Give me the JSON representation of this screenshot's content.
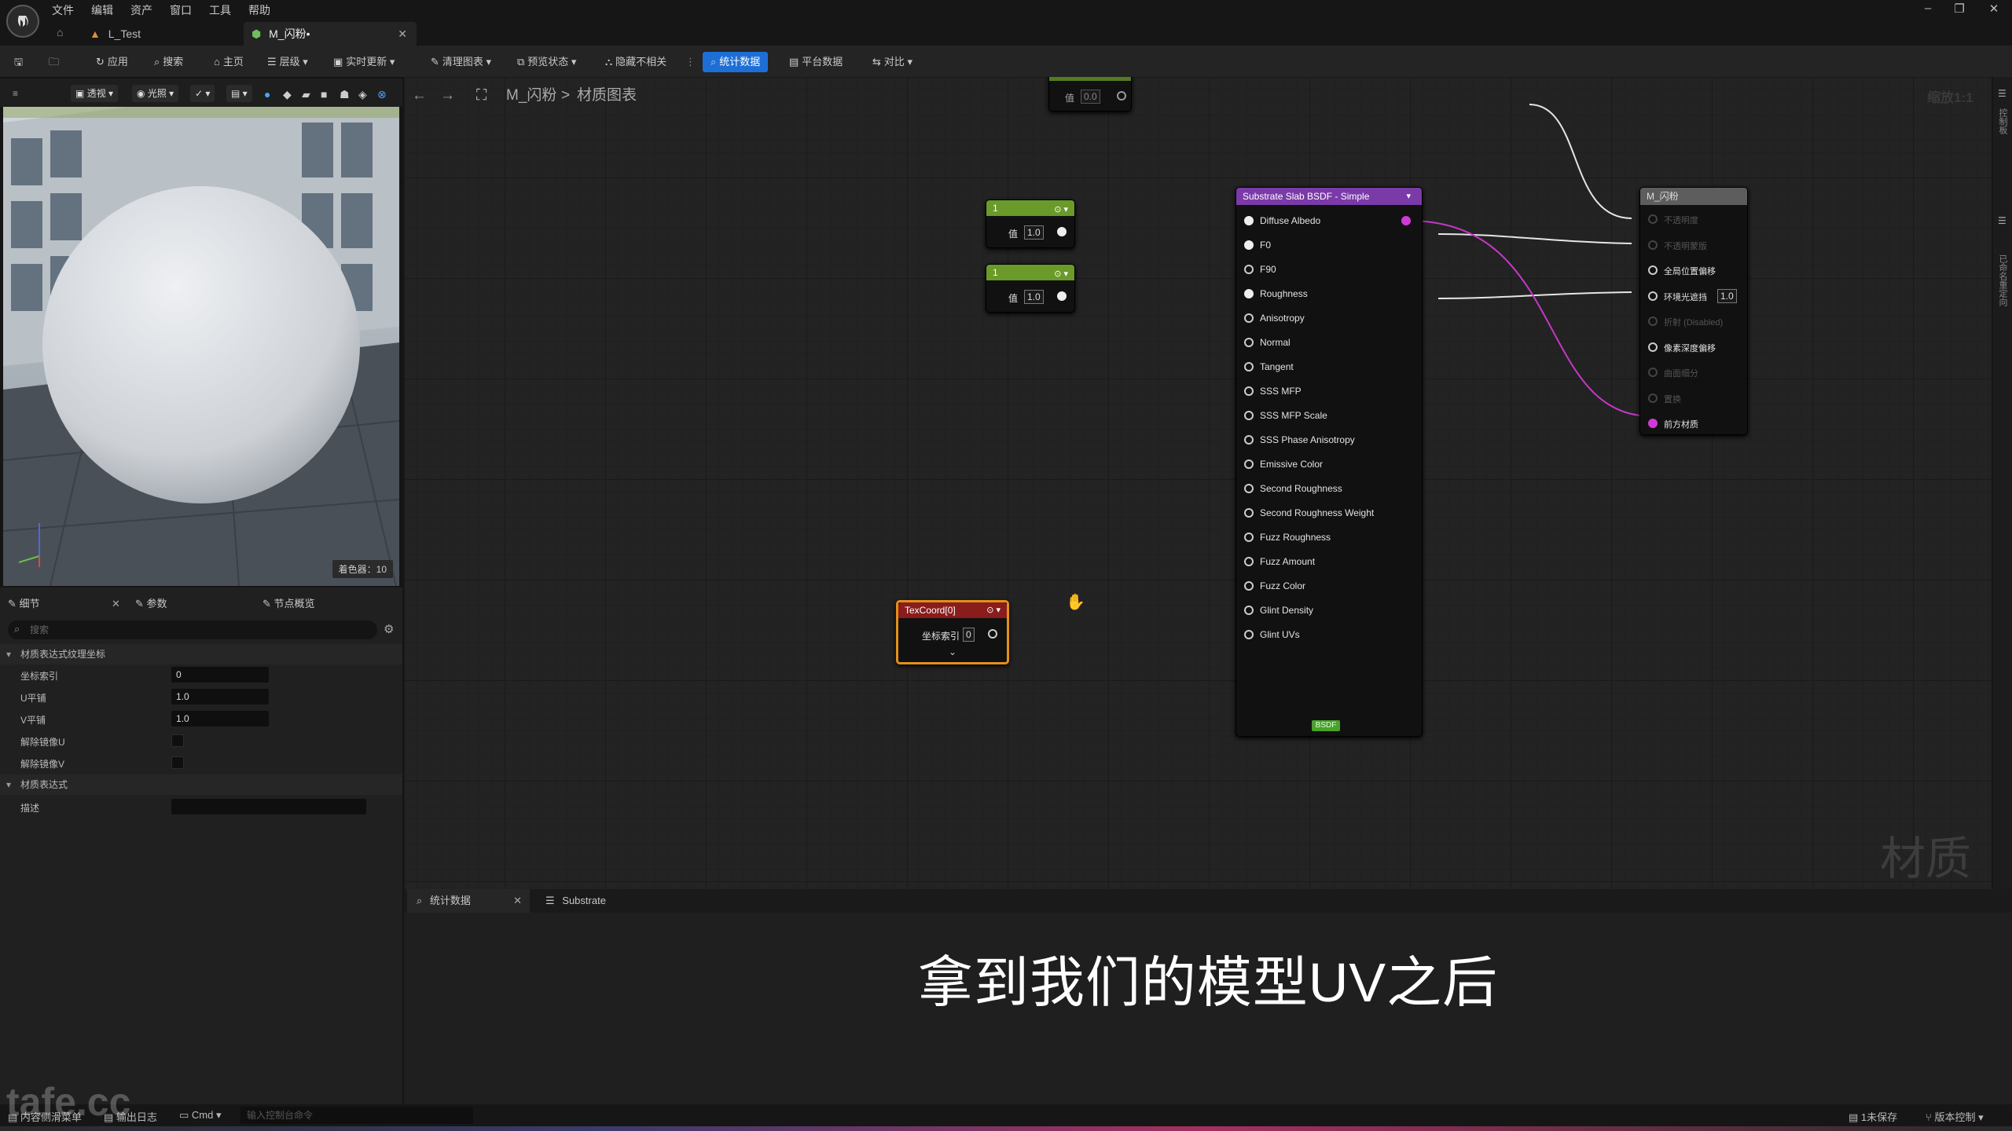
{
  "menu": [
    "文件",
    "编辑",
    "资产",
    "窗口",
    "工具",
    "帮助"
  ],
  "tabs": {
    "level": "L_Test",
    "material": "M_闪粉•"
  },
  "window_controls": [
    "–",
    "❐",
    "✕"
  ],
  "toolbar": {
    "apply": "应用",
    "search": "搜索",
    "home": "主页",
    "hierarchy": "层级",
    "live_update": "实时更新",
    "clean_graph": "清理图表",
    "preview_state": "预览状态",
    "hide_unrelated": "隐藏不相关",
    "stats": "统计数据",
    "platform_stats": "平台数据",
    "compare": "对比"
  },
  "viewport": {
    "perspective": "透视",
    "lit": "光照",
    "shader_count": "着色器：10"
  },
  "details": {
    "tabs": [
      "细节",
      "参数",
      "节点概览"
    ],
    "search_placeholder": "搜索",
    "section1": "材质表达式纹理坐标",
    "props": [
      {
        "label": "坐标索引",
        "value": "0"
      },
      {
        "label": "U平铺",
        "value": "1.0"
      },
      {
        "label": "V平铺",
        "value": "1.0"
      }
    ],
    "checks": [
      "解除镜像U",
      "解除镜像V"
    ],
    "section2": "材质表达式",
    "desc_label": "描述"
  },
  "graph": {
    "breadcrumb_root": "M_闪粉",
    "breadcrumb_sep": ">",
    "breadcrumb_page": "材质图表",
    "zoom": "缩放1:1",
    "watermark": "材质"
  },
  "nodes": {
    "top_const": {
      "label": "值",
      "value": "0.0"
    },
    "const1": {
      "title": "1",
      "label": "值",
      "value": "1.0"
    },
    "const2": {
      "title": "1",
      "label": "值",
      "value": "1.0"
    },
    "texcoord": {
      "title": "TexCoord[0]",
      "label": "坐标索引",
      "value": "0"
    },
    "substrate": {
      "title": "Substrate Slab BSDF - Simple",
      "inputs": [
        "Diffuse Albedo",
        "F0",
        "F90",
        "Roughness",
        "Anisotropy",
        "Normal",
        "Tangent",
        "SSS MFP",
        "SSS MFP Scale",
        "SSS Phase Anisotropy",
        "Emissive Color",
        "Second Roughness",
        "Second Roughness Weight",
        "Fuzz Roughness",
        "Fuzz Amount",
        "Fuzz Color",
        "Glint Density",
        "Glint UVs"
      ],
      "badge": "BSDF"
    },
    "output": {
      "title": "M_闪粉",
      "pins": [
        {
          "label": "不透明度",
          "active": false
        },
        {
          "label": "不透明蒙版",
          "active": false
        },
        {
          "label": "全局位置偏移",
          "active": true
        },
        {
          "label": "环境光遮挡",
          "active": true,
          "value": "1.0"
        },
        {
          "label": "折射 (Disabled)",
          "active": false
        },
        {
          "label": "像素深度偏移",
          "active": true
        },
        {
          "label": "曲面细分",
          "active": false
        },
        {
          "label": "置换",
          "active": false
        },
        {
          "label": "前方材质",
          "active": true
        }
      ]
    }
  },
  "bottom_tabs": [
    "统计数据",
    "Substrate"
  ],
  "subtitle": "拿到我们的模型UV之后",
  "statusbar": {
    "content_drawer": "内容侧滑菜单",
    "output_log": "输出日志",
    "cmd": "Cmd",
    "console_placeholder": "输入控制台命令",
    "unsaved": "1未保存",
    "source_control": "版本控制"
  },
  "right_side": [
    "控制板",
    "已命名重定向"
  ],
  "brand_watermark": "tafe.cc",
  "colors": {
    "accent": "#1d6fd6",
    "const_node": "#6a9a2a",
    "substrate_node": "#7a3aa8",
    "texcoord_node": "#8a1c1c",
    "selected": "#e3901a",
    "wire_pink": "#c538c8"
  }
}
